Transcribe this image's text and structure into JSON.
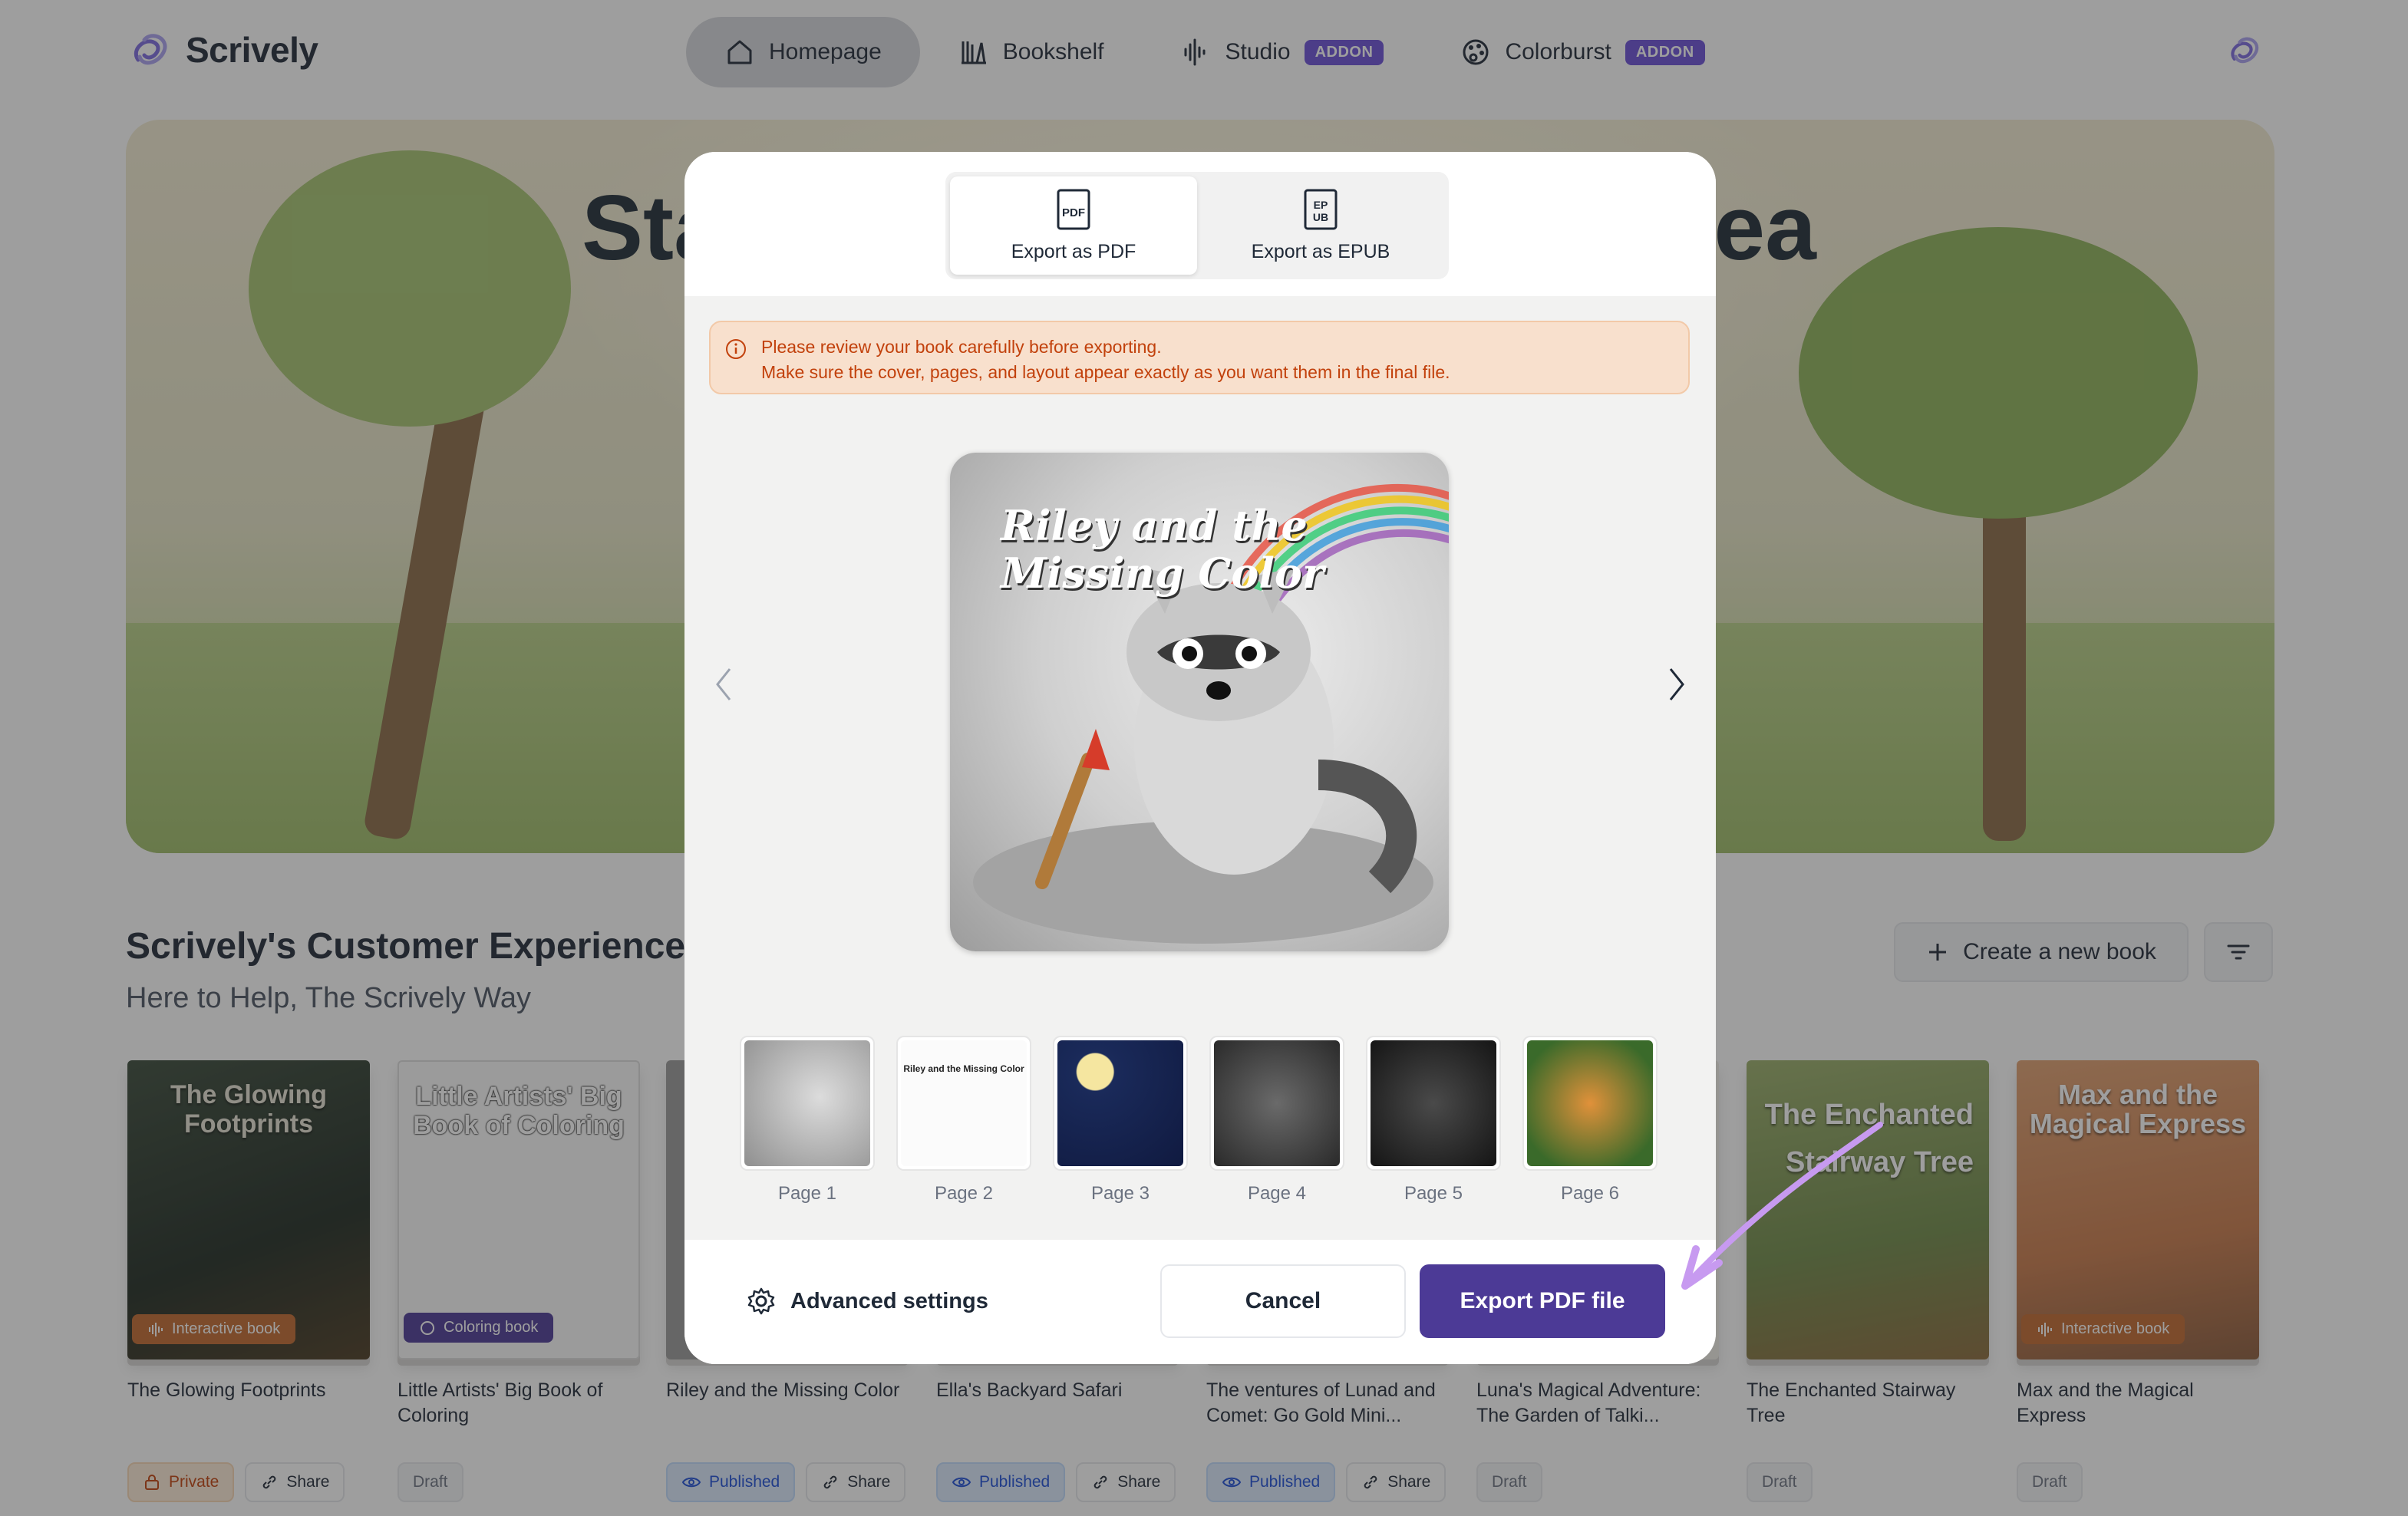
{
  "nav": {
    "brand": "Scrively",
    "items": [
      {
        "label": "Homepage",
        "icon": "home-icon",
        "active": true,
        "addon": ""
      },
      {
        "label": "Bookshelf",
        "icon": "bookshelf-icon",
        "active": false,
        "addon": ""
      },
      {
        "label": "Studio",
        "icon": "audio-wave-icon",
        "active": false,
        "addon": "ADDON"
      },
      {
        "label": "Colorburst",
        "icon": "palette-icon",
        "active": false,
        "addon": "ADDON"
      }
    ]
  },
  "hero": {
    "title_left": "Sta",
    "title_right": "lea"
  },
  "section": {
    "title": "Scrively's Customer Experience T",
    "subtitle": "Here to Help, The Scrively Way",
    "create_label": "Create a new book"
  },
  "books": [
    {
      "title": "The Glowing Footprints",
      "cover_text": "The Glowing Footprints",
      "badge": "Interactive book",
      "tags": [
        "Private",
        "Share"
      ]
    },
    {
      "title": "Little Artists' Big Book of Coloring",
      "cover_text": "Little Artists' Big Book of Coloring",
      "badge": "Coloring book",
      "tags": [
        "Draft"
      ]
    },
    {
      "title": "Riley and the Missing Color",
      "tags": [
        "Published",
        "Share"
      ]
    },
    {
      "title": "Ella's Backyard Safari",
      "tags": [
        "Published",
        "Share"
      ]
    },
    {
      "title": "The ventures of Lunad and Comet: Go Gold Mini...",
      "tags": [
        "Published",
        "Share"
      ]
    },
    {
      "title": "Luna's Magical Adventure: The Garden of Talki...",
      "tags": [
        "Draft"
      ]
    },
    {
      "title": "The Enchanted Stairway Tree",
      "cover_text": "The Enchanted Stairway Tree",
      "tags": [
        "Draft"
      ]
    },
    {
      "title": "Max and the Magical Express",
      "cover_text": "Max and the Magical Express",
      "badge": "Interactive book",
      "tags": [
        "Draft"
      ]
    }
  ],
  "modal": {
    "tabs": [
      {
        "label": "Export as PDF",
        "icon": "pdf-icon",
        "active": true
      },
      {
        "label": "Export as EPUB",
        "icon": "epub-icon",
        "active": false
      }
    ],
    "warning_line1": "Please review your book carefully before exporting.",
    "warning_line2": "Make sure the cover, pages, and layout appear exactly as you want them in the final file.",
    "preview_title": "Riley and the Missing Color",
    "pages": [
      "Page 1",
      "Page 2",
      "Page 3",
      "Page 4",
      "Page 5",
      "Page 6"
    ],
    "page2_title": "Riley and the Missing Color",
    "advanced_label": "Advanced settings",
    "cancel_label": "Cancel",
    "export_label": "Export PDF file"
  },
  "colors": {
    "accent": "#4c3a96",
    "addon": "#6b4fd8",
    "warning_bg": "#f8e0cd",
    "warning_text": "#c2410c"
  }
}
